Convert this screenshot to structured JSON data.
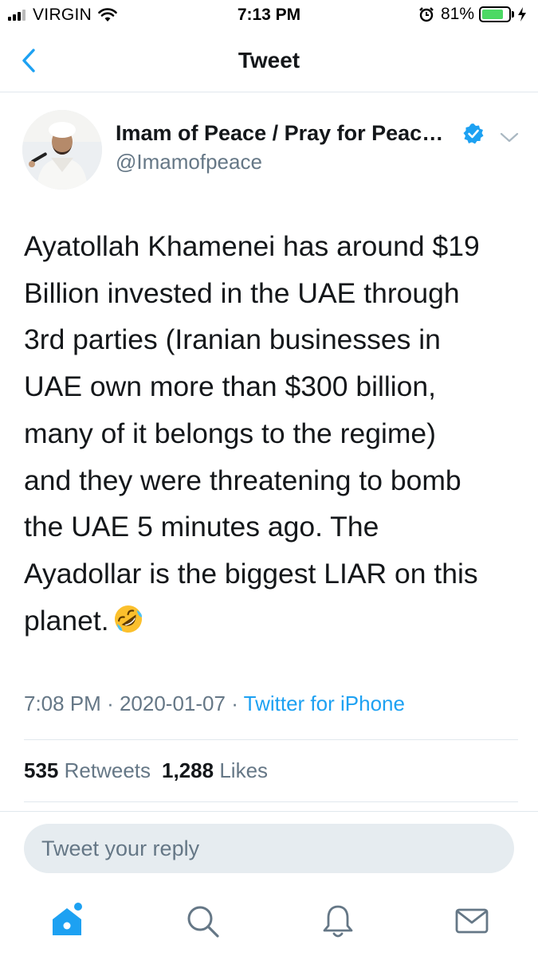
{
  "status_bar": {
    "carrier": "VIRGIN",
    "time": "7:13 PM",
    "battery_percent": "81%",
    "battery_level": 0.81,
    "battery_color": "#4cd964"
  },
  "nav": {
    "back_icon": "chevron-left-icon",
    "title": "Tweet"
  },
  "tweet": {
    "display_name": "Imam of Peace / Pray for Peac…",
    "handle": "@Imamofpeace",
    "verified": true,
    "text_lines": [
      "Ayatollah Khamenei has around $19",
      "Billion invested in the UAE through",
      "3rd parties (Iranian businesses in",
      "UAE own more than $300 billion,",
      "many of it belongs to the regime)",
      "and they were threatening to bomb",
      "the UAE 5 minutes ago. The",
      "Ayadollar is the biggest LIAR on this",
      "planet."
    ],
    "emoji": "rolling-on-floor-laughing-emoji",
    "time": "7:08 PM",
    "date": "2020-01-07",
    "separator": "·",
    "source": "Twitter for iPhone",
    "retweets_count": "535",
    "retweets_label": "Retweets",
    "likes_count": "1,288",
    "likes_label": "Likes"
  },
  "reply": {
    "placeholder": "Tweet your reply"
  },
  "tabbar": {
    "items": [
      "home-icon",
      "search-icon",
      "notifications-icon",
      "messages-icon"
    ],
    "accent": "#1da1f2",
    "inactive": "#657786"
  }
}
